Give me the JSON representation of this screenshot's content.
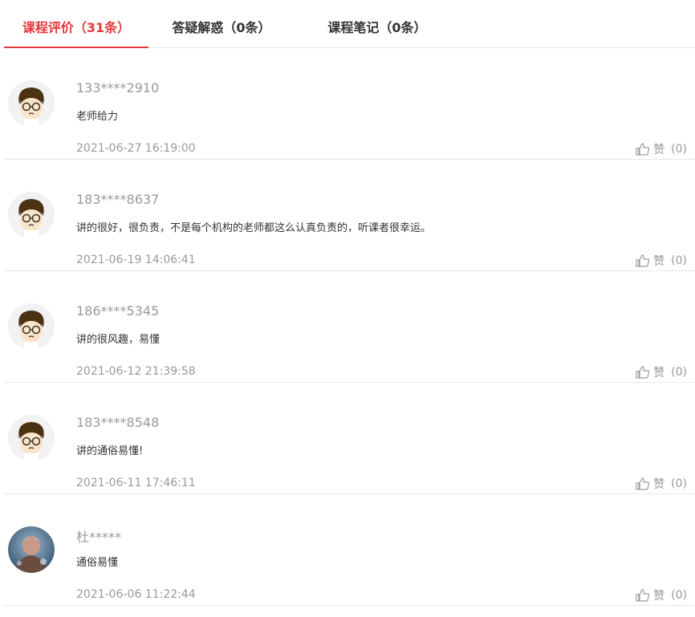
{
  "tabs": [
    {
      "label": "课程评价（31条）",
      "active": true
    },
    {
      "label": "答疑解惑（0条）",
      "active": false
    },
    {
      "label": "课程笔记（0条）",
      "active": false
    }
  ],
  "reviews": [
    {
      "user": "133****2910",
      "comment": "老师给力",
      "time": "2021-06-27 16:19:00",
      "like_label": "赞",
      "like_count": "(0)",
      "avatar": "cartoon-boy-icon"
    },
    {
      "user": "183****8637",
      "comment": "讲的很好，很负责，不是每个机构的老师都这么认真负责的，听课者很幸运。",
      "time": "2021-06-19 14:06:41",
      "like_label": "赞",
      "like_count": "(0)",
      "avatar": "cartoon-boy-icon"
    },
    {
      "user": "186****5345",
      "comment": "讲的很风趣，易懂",
      "time": "2021-06-12 21:39:58",
      "like_label": "赞",
      "like_count": "(0)",
      "avatar": "cartoon-boy-icon"
    },
    {
      "user": "183****8548",
      "comment": "讲的通俗易懂!",
      "time": "2021-06-11 17:46:11",
      "like_label": "赞",
      "like_count": "(0)",
      "avatar": "cartoon-boy-icon"
    },
    {
      "user": "杜*****",
      "comment": "通俗易懂",
      "time": "2021-06-06 11:22:44",
      "like_label": "赞",
      "like_count": "(0)",
      "avatar": "photo-avatar-icon"
    }
  ],
  "colors": {
    "accent": "#e4393c",
    "muted": "#999999",
    "text": "#333333",
    "divider": "#e8e8e8"
  }
}
